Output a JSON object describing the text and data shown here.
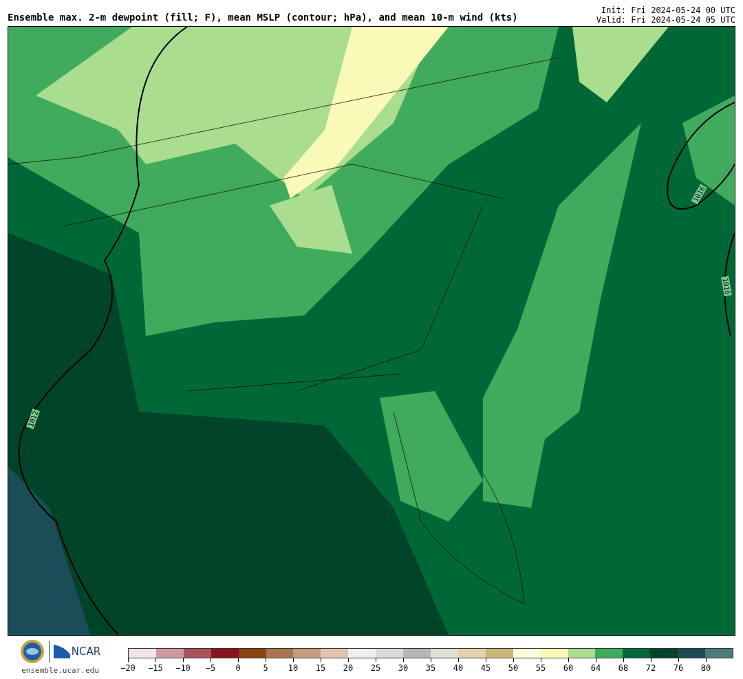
{
  "title": "Ensemble max. 2-m dewpoint (fill; F), mean MSLP (contour; hPa), and mean 10-m wind (kts)",
  "init": "Init: Fri 2024-05-24 00 UTC",
  "valid": "Valid: Fri 2024-05-24 05 UTC",
  "map": {
    "contour_labels": [
      "1012",
      "1016",
      "1016"
    ]
  },
  "footer": {
    "logo_text": "NCAR",
    "site": "ensemble.ucar.edu"
  },
  "colorbar": {
    "bins": [
      {
        "color": "#f3e4e6",
        "tick": "−20"
      },
      {
        "color": "#d0999f",
        "tick": "−15"
      },
      {
        "color": "#a8545c",
        "tick": "−10"
      },
      {
        "color": "#8a1420",
        "tick": "−5"
      },
      {
        "color": "#8a4511",
        "tick": "0"
      },
      {
        "color": "#a8754f",
        "tick": "5"
      },
      {
        "color": "#c49c7f",
        "tick": "10"
      },
      {
        "color": "#e0c4b0",
        "tick": "15"
      },
      {
        "color": "#eeeeee",
        "tick": "20"
      },
      {
        "color": "#dadada",
        "tick": "25"
      },
      {
        "color": "#b6b6b6",
        "tick": "30"
      },
      {
        "color": "#e0dfd3",
        "tick": "35"
      },
      {
        "color": "#e3d3ad",
        "tick": "40"
      },
      {
        "color": "#cbb679",
        "tick": "45"
      },
      {
        "color": "#fdfde0",
        "tick": "50"
      },
      {
        "color": "#f9f9b8",
        "tick": "55"
      },
      {
        "color": "#aadd8e",
        "tick": "60"
      },
      {
        "color": "#41ab5d",
        "tick": "64"
      },
      {
        "color": "#006837",
        "tick": "68"
      },
      {
        "color": "#004529",
        "tick": "72"
      },
      {
        "color": "#1a4d55",
        "tick": "76"
      },
      {
        "color": "#4b7a7a",
        "tick": "80"
      }
    ]
  }
}
